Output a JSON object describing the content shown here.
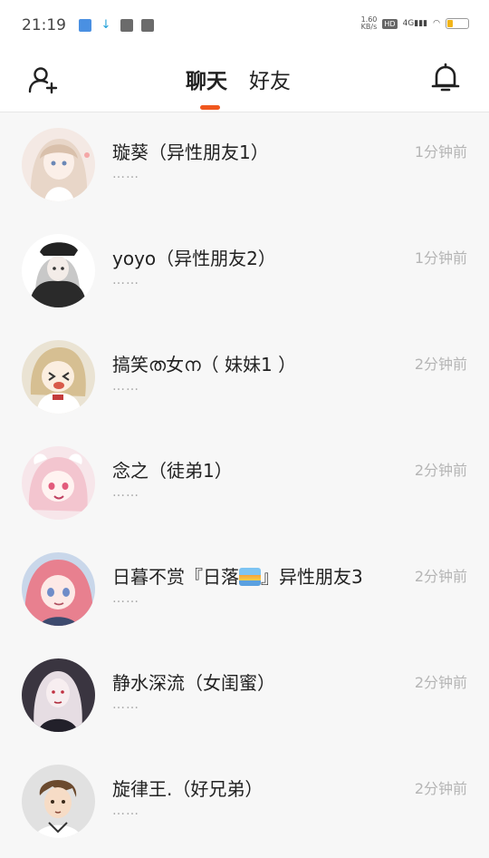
{
  "status_bar": {
    "time": "21:19",
    "net_speed": "1.60\nKB/s",
    "hd": "HD",
    "signal": "4G",
    "battery_fill": 0.22
  },
  "nav": {
    "tabs": [
      {
        "label": "聊天",
        "active": true
      },
      {
        "label": "好友",
        "active": false
      }
    ],
    "accent_color": "#f0571e"
  },
  "chats": [
    {
      "name": "璇葵（异性朋友1）",
      "preview": "……",
      "time": "1分钟前"
    },
    {
      "name": "yoyo（异性朋友2）",
      "preview": "……",
      "time": "1分钟前"
    },
    {
      "name": "搞笑ത女ന（ 妹妹1 ）",
      "preview": "……",
      "time": "2分钟前"
    },
    {
      "name": "念之（徒弟1）",
      "preview": "……",
      "time": "2分钟前"
    },
    {
      "name_pre": "日暮不赏『日落",
      "name_post": "』异性朋友3",
      "preview": "……",
      "time": "2分钟前"
    },
    {
      "name": "静水深流（女闺蜜）",
      "preview": "……",
      "time": "2分钟前"
    },
    {
      "name": "旋律王.（好兄弟）",
      "preview": "……",
      "time": "2分钟前"
    }
  ]
}
